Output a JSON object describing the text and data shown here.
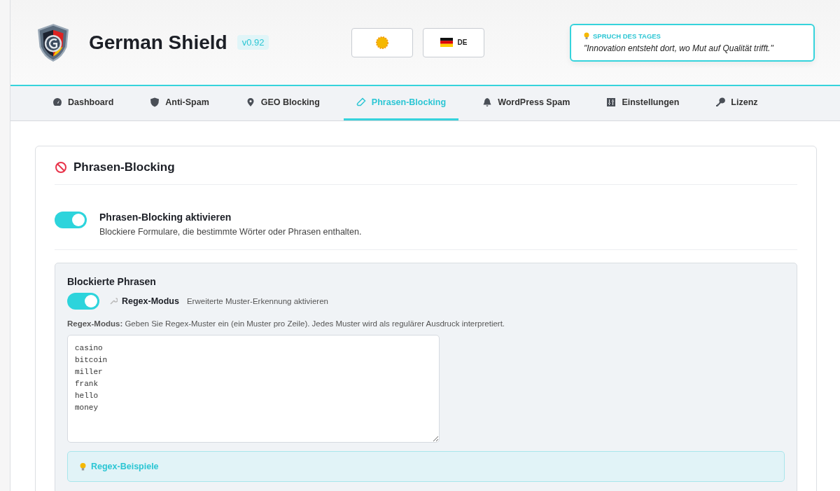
{
  "header": {
    "title": "German Shield",
    "version": "v0.92",
    "language": "DE",
    "quote": {
      "label": "SPRUCH DES TAGES",
      "text": "\"Innovation entsteht dort, wo Mut auf Qualität trifft.\""
    }
  },
  "tabs": [
    {
      "label": "Dashboard",
      "kind": "gauge",
      "selected": false
    },
    {
      "label": "Anti-Spam",
      "kind": "shield",
      "selected": false
    },
    {
      "label": "GEO Blocking",
      "kind": "pin",
      "selected": false
    },
    {
      "label": "Phrasen-Blocking",
      "kind": "eraser",
      "selected": true
    },
    {
      "label": "WordPress Spam",
      "kind": "bell",
      "selected": false
    },
    {
      "label": "Einstellungen",
      "kind": "sliders",
      "selected": false
    },
    {
      "label": "Lizenz",
      "kind": "key",
      "selected": false
    }
  ],
  "section": {
    "title": "Phrasen-Blocking",
    "enable": {
      "label": "Phrasen-Blocking aktivieren",
      "description": "Blockiere Formulare, die bestimmte Wörter oder Phrasen enthalten.",
      "on": true
    },
    "phrases": {
      "title": "Blockierte Phrasen",
      "regex": {
        "label": "Regex-Modus",
        "description": "Erweiterte Muster-Erkennung aktivieren",
        "on": true
      },
      "hint": "**Regex-Modus:** Geben Sie Regex-Muster ein (ein Muster pro Zeile). Jedes Muster wird als regulärer Ausdruck interpretiert.",
      "value": "casino\nbitcoin\nmiller\nfrank\nhello\nmoney",
      "examples_title": "Regex-Beispiele"
    }
  }
}
